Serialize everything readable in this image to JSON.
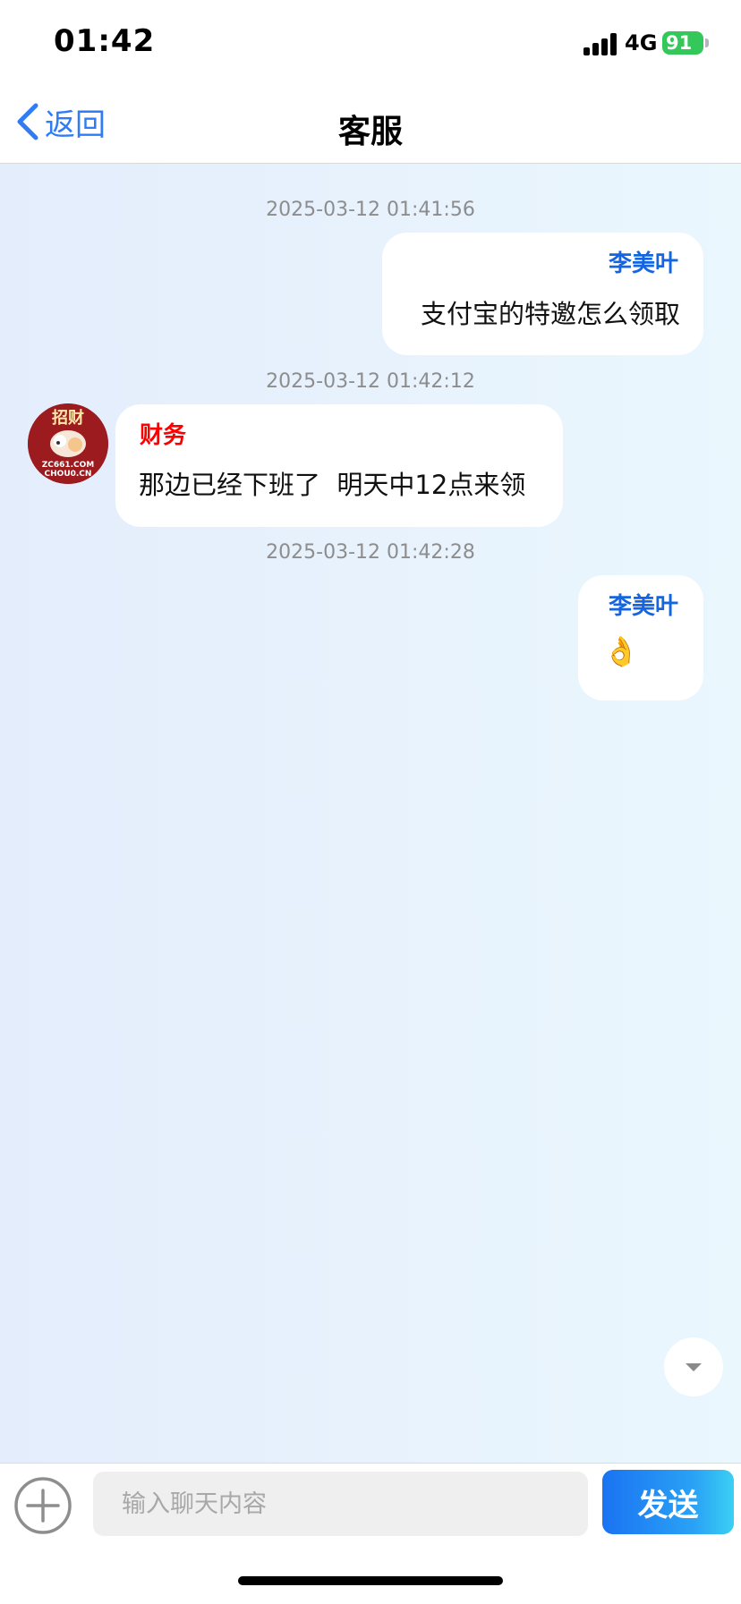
{
  "status_bar": {
    "time": "01:42",
    "network": "4G",
    "battery": "91"
  },
  "nav": {
    "back_label": "返回",
    "title": "客服"
  },
  "messages": [
    {
      "timestamp": "2025-03-12 01:41:56",
      "direction": "outgoing",
      "sender": "李美叶",
      "text": "支付宝的特邀怎么领取"
    },
    {
      "timestamp": "2025-03-12 01:42:12",
      "direction": "incoming",
      "sender": "财务",
      "text": "那边已经下班了  明天中12点来领"
    },
    {
      "timestamp": "2025-03-12 01:42:28",
      "direction": "outgoing",
      "sender": "李美叶",
      "text": "👌"
    }
  ],
  "avatar_text": {
    "top": "招财",
    "line1": "ZC661.COM",
    "line2": "CHOU0.CN"
  },
  "input": {
    "placeholder": "输入聊天内容",
    "value": "",
    "send_label": "发送"
  },
  "colors": {
    "accent": "#2f7cf6",
    "self_name": "#1565e0",
    "agent_name": "#ff0000",
    "battery": "#34c759"
  },
  "icons": [
    "chevron-left-icon",
    "plus-circle-icon",
    "chevron-down-icon",
    "signal-icon",
    "battery-icon"
  ]
}
